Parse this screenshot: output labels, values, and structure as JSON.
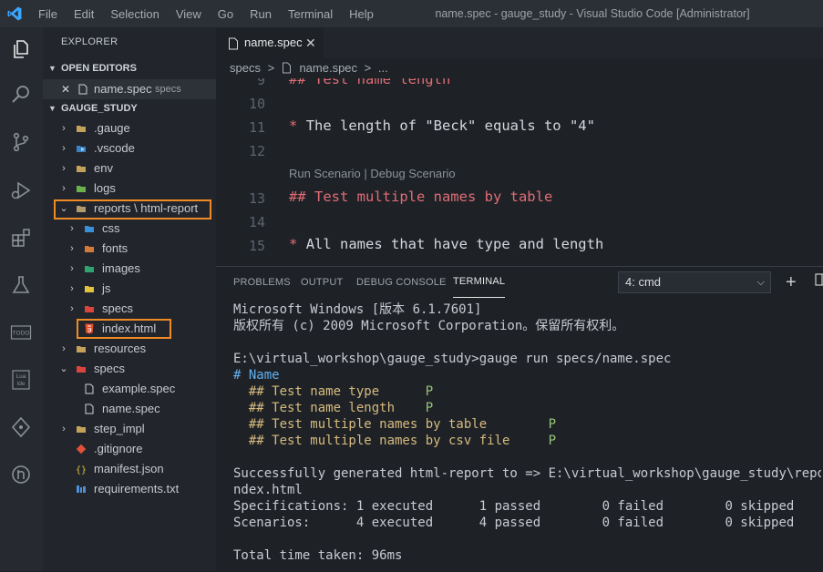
{
  "titlebar": {
    "menu": [
      "File",
      "Edit",
      "Selection",
      "View",
      "Go",
      "Run",
      "Terminal",
      "Help"
    ],
    "title": "name.spec - gauge_study - Visual Studio Code [Administrator]"
  },
  "activity_icons": [
    "explorer-icon",
    "search-icon",
    "source-control-icon",
    "run-debug-icon",
    "extensions-icon",
    "test-flask-icon",
    "todo-icon",
    "lua-ide-icon",
    "git-graph-icon",
    "remote-icon"
  ],
  "activity_text": {
    "todo": "TODO",
    "lua_line1": "Lua",
    "lua_line2": "Ide"
  },
  "explorer": {
    "title": "EXPLORER",
    "open_editors_title": "OPEN EDITORS",
    "open_editor": {
      "close": "✕",
      "name": "name.spec",
      "folder": "specs"
    },
    "project_title": "GAUGE_STUDY",
    "tree": [
      {
        "label": ".gauge",
        "icon": "folder-icon"
      },
      {
        "label": ".vscode",
        "icon": "folder-vscode-icon"
      },
      {
        "label": "env",
        "icon": "folder-icon"
      },
      {
        "label": "logs",
        "icon": "folder-logs-icon"
      },
      {
        "label": "reports \\ html-report",
        "icon": "folder-open-icon"
      },
      {
        "label": "css",
        "icon": "folder-css-icon"
      },
      {
        "label": "fonts",
        "icon": "folder-fonts-icon"
      },
      {
        "label": "images",
        "icon": "folder-images-icon"
      },
      {
        "label": "js",
        "icon": "folder-js-icon"
      },
      {
        "label": "specs",
        "icon": "folder-specs-icon"
      },
      {
        "label": "index.html",
        "icon": "html5-icon"
      },
      {
        "label": "resources",
        "icon": "folder-icon"
      },
      {
        "label": "specs",
        "icon": "folder-specs-open-icon"
      },
      {
        "label": "example.spec",
        "icon": "file-icon"
      },
      {
        "label": "name.spec",
        "icon": "file-icon"
      },
      {
        "label": "step_impl",
        "icon": "folder-icon"
      },
      {
        "label": ".gitignore",
        "icon": "git-icon"
      },
      {
        "label": "manifest.json",
        "icon": "json-icon"
      },
      {
        "label": "requirements.txt",
        "icon": "txt-icon"
      }
    ]
  },
  "editor": {
    "tab": {
      "label": "name.spec",
      "close": "✕"
    },
    "breadcrumb": {
      "folder": "specs",
      "sep": ">",
      "file": "name.spec",
      "more": "..."
    },
    "lines": [
      {
        "num": "9",
        "text": "## Test name length"
      },
      {
        "num": "10",
        "text": ""
      },
      {
        "num": "11",
        "text": "* The length of \"Beck\" equals to \"4\""
      },
      {
        "num": "12",
        "text": ""
      },
      {
        "num": "13",
        "text": "## Test multiple names by table"
      },
      {
        "num": "14",
        "text": ""
      },
      {
        "num": "15",
        "text": "* All names that have type and length"
      }
    ],
    "codelens": "Run Scenario | Debug Scenario"
  },
  "panel": {
    "tabs": [
      "PROBLEMS",
      "OUTPUT",
      "DEBUG CONSOLE",
      "TERMINAL"
    ],
    "terminal_select": "4: cmd",
    "terminal_lines": [
      "Microsoft Windows [版本 6.1.7601]",
      "版权所有 (c) 2009 Microsoft Corporation。保留所有权利。",
      "",
      "E:\\virtual_workshop\\gauge_study>gauge run specs/name.spec",
      "# Name",
      "  ## Test name type      P",
      "  ## Test name length    P",
      "  ## Test multiple names by table        P",
      "  ## Test multiple names by csv file     P",
      "",
      "Successfully generated html-report to => E:\\virtual_workshop\\gauge_study\\reports\\html-report\\i",
      "ndex.html",
      "Specifications: 1 executed      1 passed        0 failed        0 skipped",
      "Scenarios:      4 executed      4 passed        0 failed        0 skipped",
      "",
      "Total time taken: 96ms"
    ]
  },
  "colors": {
    "accent": "#007acc",
    "highlight_box": "#f08a24",
    "markdown_heading": "#e06c75",
    "terminal_pass": "#98c379",
    "terminal_heading": "#61afef"
  }
}
